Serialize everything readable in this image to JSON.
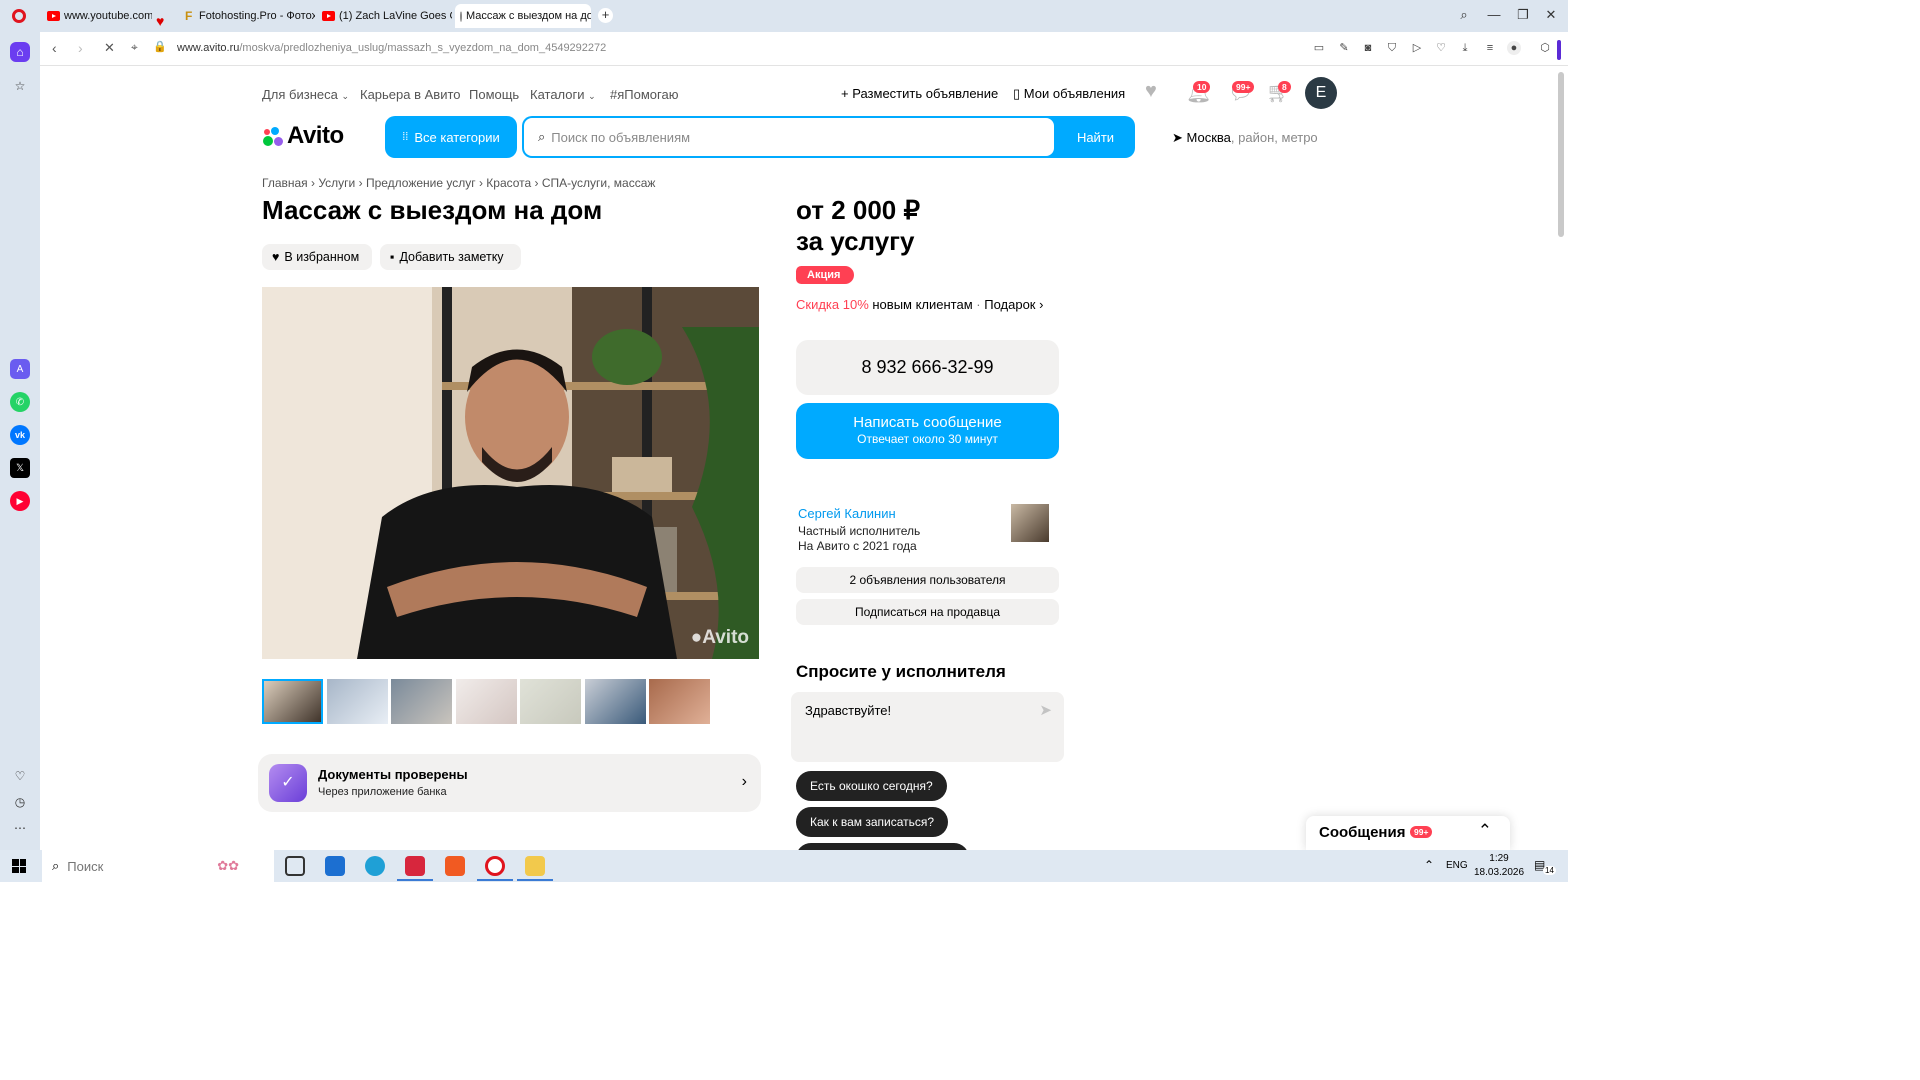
{
  "browser": {
    "tabs": [
      {
        "title": "www.youtube.com"
      },
      {
        "title": "Fotohosting.Pro - Фотохо"
      },
      {
        "title": "(1) Zach LaVine Goes OFF"
      },
      {
        "title": "Массаж с выездом на до"
      }
    ],
    "url_domain": "www.avito.ru",
    "url_path": "/moskva/predlozheniya_uslug/massazh_s_vyezdom_na_dom_4549292272"
  },
  "header": {
    "top_links": [
      "Для бизнеса",
      "Карьера в Авито",
      "Помощь",
      "Каталоги",
      "#яПомогаю"
    ],
    "post_ad": "Разместить объявление",
    "my_ads": "Мои объявления",
    "badges": {
      "notifications": "10",
      "messages": "99+",
      "cart": "8"
    },
    "avatar_letter": "E"
  },
  "logo_text": "Avito",
  "search": {
    "all_categories": "Все категории",
    "placeholder": "Поиск по объявлениям",
    "button": "Найти",
    "location_city": "Москва",
    "location_hint": ", район, метро"
  },
  "breadcrumbs": [
    "Главная",
    "Услуги",
    "Предложение услуг",
    "Красота",
    "СПА-услуги, массаж"
  ],
  "listing": {
    "title": "Массаж с выездом на дом",
    "favorite_label": "В избранном",
    "note_label": "Добавить заметку",
    "watermark": "Avito",
    "thumb_count": 7,
    "docs_title": "Документы проверены",
    "docs_sub": "Через приложение банка"
  },
  "price": {
    "line1": "от 2 000 ₽",
    "line2": "за услугу",
    "promo": "Акция",
    "discount": "Скидка 10%",
    "discount_rest": " новым клиентам",
    "gift": "Подарок"
  },
  "contact": {
    "phone": "8 932 666-32-99",
    "message_title": "Написать сообщение",
    "message_sub": "Отвечает около 30 минут"
  },
  "seller": {
    "name": "Сергей Калинин",
    "type": "Частный исполнитель",
    "since": "На Авито с 2021 года",
    "ads_button": "2 объявления пользователя",
    "subscribe_button": "Подписаться на продавца"
  },
  "ask": {
    "title": "Спросите у исполнителя",
    "input_value": "Здравствуйте!",
    "quick_questions": [
      "Есть окошко сегодня?",
      "Как к вам записаться?"
    ]
  },
  "messages_panel": {
    "label": "Сообщения",
    "badge": "99+"
  },
  "taskbar": {
    "search_placeholder": "Поиск",
    "lang": "ENG",
    "time": "1:29",
    "date": "18.03.2026",
    "notif_count": "14"
  },
  "colors": {
    "accent": "#00aaff",
    "promo": "#ff4053",
    "chip_bg": "#f2f1f0"
  }
}
